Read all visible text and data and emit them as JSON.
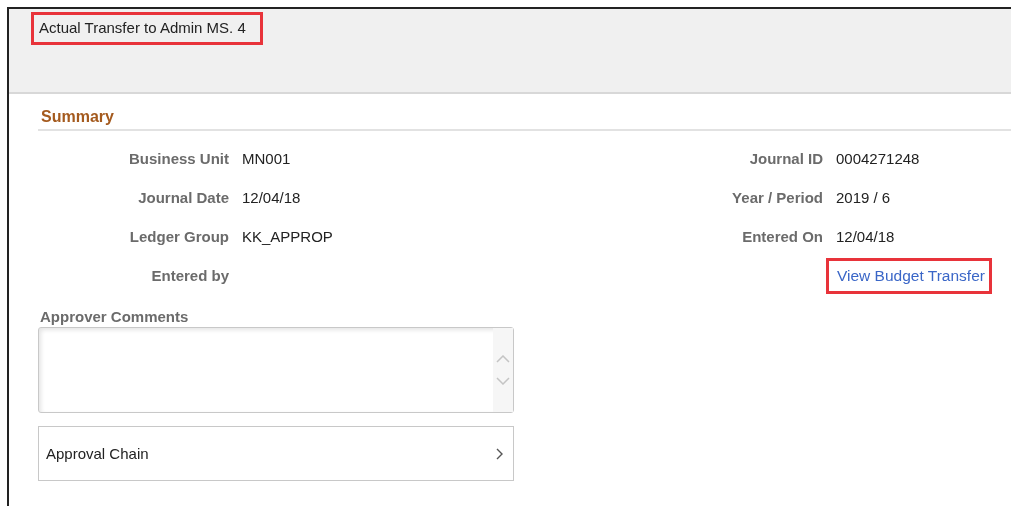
{
  "header": {
    "title": "Actual Transfer to Admin MS. 4",
    "highlighted": true
  },
  "summary": {
    "heading": "Summary",
    "left_fields": [
      {
        "label": "Business Unit",
        "value": "MN001"
      },
      {
        "label": "Journal Date",
        "value": "12/04/18"
      },
      {
        "label": "Ledger Group",
        "value": "KK_APPROP"
      },
      {
        "label": "Entered by"
      }
    ],
    "right_fields": [
      {
        "label": "Journal ID",
        "value": "0004271248"
      },
      {
        "label": "Year / Period",
        "value": "2019 / 6"
      },
      {
        "label": "Entered On",
        "value": "12/04/18"
      }
    ],
    "link": {
      "text": "View Budget Transfer",
      "highlighted": true
    }
  },
  "approver_comments": {
    "label": "Approver Comments"
  },
  "approval_chain": {
    "label": "Approval Chain"
  }
}
